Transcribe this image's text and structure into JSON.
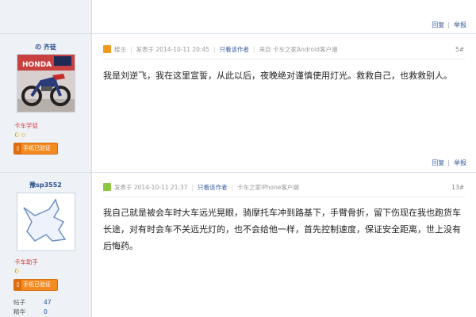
{
  "top_actions": {
    "reply": "回复",
    "report": "举报"
  },
  "posts": [
    {
      "username": "の 齐徒",
      "level": "卡车学徒",
      "medals": "☪✩",
      "verify": "手机已验证",
      "owner_badge": "楼主",
      "posted": "发表于 2014-10-11 20:45",
      "view_only": "只看该作者",
      "source": "来自 卡车之家Android客户端",
      "floor": "5#",
      "content": "我是刘逆飞，我在这里宣誓，从此以后，夜晚绝对谨慎使用灯光。救救自己，也救救别人。",
      "reply": "回复",
      "report": "举报",
      "avatar_colors": {
        "sky": "#d9c9c8",
        "bike": "#2b3b7a",
        "accent": "#c62b2b"
      }
    },
    {
      "username": "豫sp3552",
      "level": "卡车助手",
      "medals": "☪",
      "verify": "手机已验证",
      "posted": "发表于 2014-10-11 21:37",
      "view_only": "只看该作者",
      "source": "卡车之家iPhone客户端",
      "floor": "13#",
      "content": "我自己就是被会车时大车远光晃眼，骑摩托车冲到路基下，手臂骨折，留下伤现在我也跑货车长途，对有时会车不关远光灯的，也不会给他一样，首先控制速度，保证安全距离，世上没有后悔药。",
      "reply": "回复",
      "report": "举报",
      "stats": [
        {
          "label": "帖子",
          "value": "47"
        },
        {
          "label": "精华",
          "value": "0"
        }
      ]
    }
  ],
  "colors": {
    "sidebar": "#eef2f7",
    "link": "#3a5b9c",
    "level": "#d34040",
    "verify": "#f48a22"
  }
}
